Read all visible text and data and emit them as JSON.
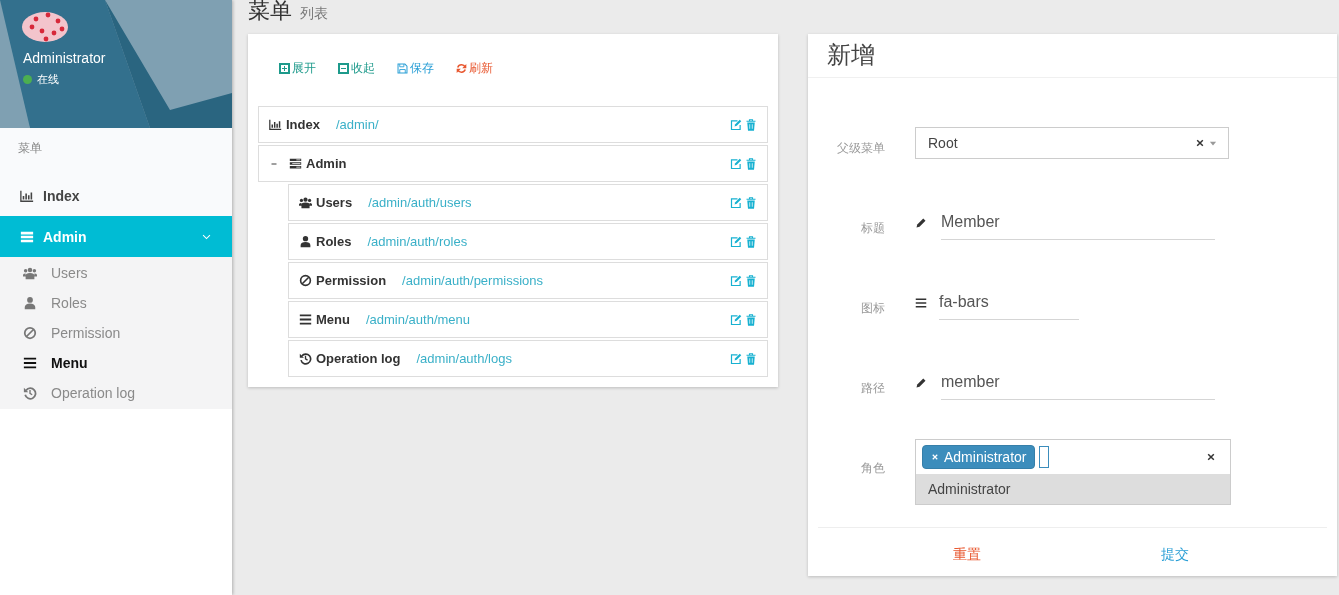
{
  "sidebar": {
    "user": {
      "name": "Administrator",
      "status": "在线"
    },
    "header": "菜单",
    "items": [
      {
        "label": "Index",
        "selected": false
      },
      {
        "label": "Admin",
        "selected": true,
        "expanded": true,
        "children": [
          {
            "label": "Users",
            "selected": false
          },
          {
            "label": "Roles",
            "selected": false
          },
          {
            "label": "Permission",
            "selected": false
          },
          {
            "label": "Menu",
            "selected": true
          },
          {
            "label": "Operation log",
            "selected": false
          }
        ]
      }
    ]
  },
  "page": {
    "title": "菜单",
    "subtitle": "列表"
  },
  "toolbar": [
    {
      "label": "展开",
      "color": "#1d9a8b"
    },
    {
      "label": "收起",
      "color": "#1d9a8b"
    },
    {
      "label": "保存",
      "color": "#2a9fd6"
    },
    {
      "label": "刷新",
      "color": "#e8572f"
    }
  ],
  "tree": [
    {
      "title": "Index",
      "uri": "/admin/"
    },
    {
      "title": "Admin",
      "expanded": true,
      "children": [
        {
          "title": "Users",
          "uri": "/admin/auth/users"
        },
        {
          "title": "Roles",
          "uri": "/admin/auth/roles"
        },
        {
          "title": "Permission",
          "uri": "/admin/auth/permissions"
        },
        {
          "title": "Menu",
          "uri": "/admin/auth/menu"
        },
        {
          "title": "Operation log",
          "uri": "/admin/auth/logs"
        }
      ]
    }
  ],
  "form": {
    "title": "新增",
    "fields": [
      {
        "label": "父级菜单",
        "kind": "select",
        "value": "Root"
      },
      {
        "label": "标题",
        "kind": "text",
        "value": "Member"
      },
      {
        "label": "图标",
        "kind": "icon",
        "value": "fa-bars"
      },
      {
        "label": "路径",
        "kind": "text",
        "value": "member"
      },
      {
        "label": "角色",
        "kind": "tags",
        "tags": [
          "Administrator"
        ],
        "options": [
          "Administrator"
        ]
      }
    ],
    "buttons": [
      {
        "label": "重置",
        "kind": "reset"
      },
      {
        "label": "提交",
        "kind": "submit"
      }
    ]
  }
}
